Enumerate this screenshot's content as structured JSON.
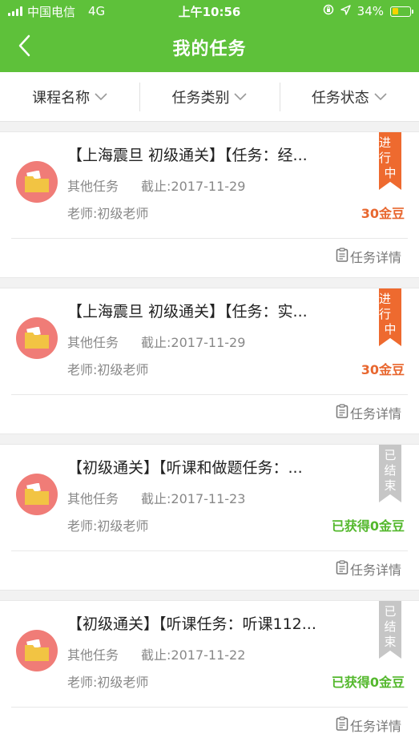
{
  "status_bar": {
    "carrier": "中国电信",
    "network": "4G",
    "time": "上午10:56",
    "battery": "34%",
    "battery_level": 0.34
  },
  "nav": {
    "title": "我的任务",
    "back_icon": "chevron-left-icon"
  },
  "filters": [
    {
      "label": "课程名称"
    },
    {
      "label": "任务类别"
    },
    {
      "label": "任务状态"
    }
  ],
  "tasks": [
    {
      "title": "【上海震旦 初级通关】【任务：经...",
      "type": "其他任务",
      "deadline": "截止:2017-11-29",
      "teacher": "老师:初级老师",
      "reward": "30金豆",
      "status_line1": "进行",
      "status_line2": "中",
      "status_kind": "active",
      "detail": "任务详情"
    },
    {
      "title": "【上海震旦 初级通关】【任务：实...",
      "type": "其他任务",
      "deadline": "截止:2017-11-29",
      "teacher": "老师:初级老师",
      "reward": "30金豆",
      "status_line1": "进行",
      "status_line2": "中",
      "status_kind": "active",
      "detail": "任务详情"
    },
    {
      "title": "【初级通关】【听课和做题任务：...",
      "type": "其他任务",
      "deadline": "截止:2017-11-23",
      "teacher": "老师:初级老师",
      "reward": "已获得0金豆",
      "status_line1": "已",
      "status_line2": "结",
      "status_line3": "束",
      "status_kind": "done",
      "detail": "任务详情"
    },
    {
      "title": "【初级通关】【听课任务：听课112...",
      "type": "其他任务",
      "deadline": "截止:2017-11-22",
      "teacher": "老师:初级老师",
      "reward": "已获得0金豆",
      "status_line1": "已",
      "status_line2": "结",
      "status_line3": "束",
      "status_kind": "done",
      "detail": "任务详情"
    }
  ],
  "colors": {
    "brand_green": "#5ec13a",
    "active_orange": "#ee6a2f",
    "done_gray": "#c6c6c6",
    "done_green": "#54b82d",
    "avatar_red": "#f07c77"
  }
}
